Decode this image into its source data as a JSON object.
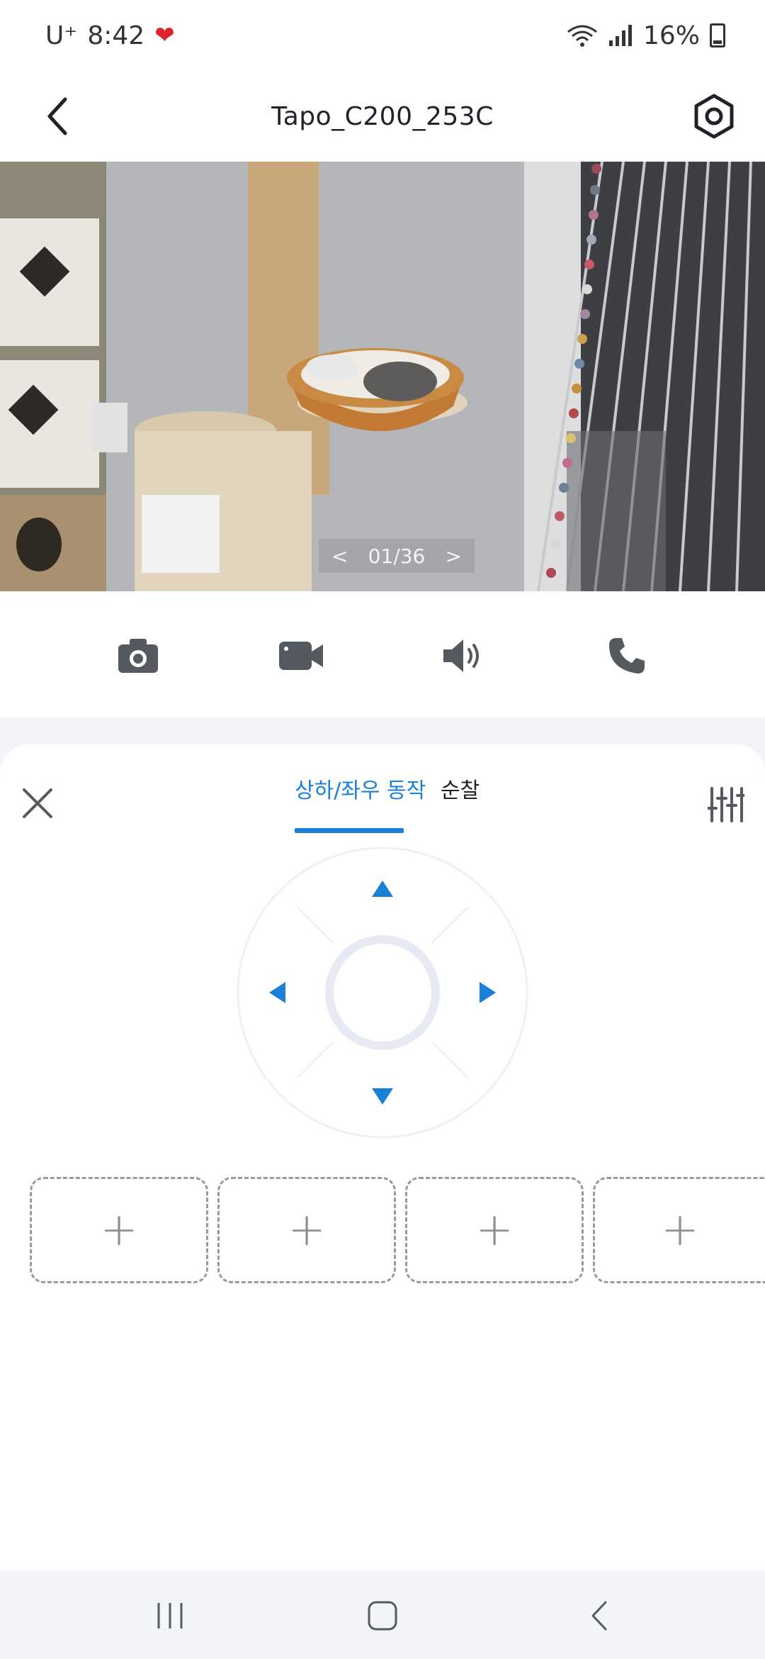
{
  "status": {
    "carrier": "U⁺",
    "time": "8:42",
    "battery": "16%"
  },
  "header": {
    "title": "Tapo_C200_253C"
  },
  "video": {
    "page_counter": "01/36",
    "prev_symbol": "<",
    "next_symbol": ">"
  },
  "controls": [
    "camera-icon",
    "video-camera-icon",
    "speaker-icon",
    "phone-icon"
  ],
  "panel": {
    "tabs": [
      "상하/좌우 동작",
      "순찰"
    ],
    "active_tab": 0
  },
  "presets": [
    {
      "label": "+"
    },
    {
      "label": "+"
    },
    {
      "label": "+"
    },
    {
      "label": "+"
    }
  ],
  "colors": {
    "accent": "#1a7fd6",
    "nav_bg": "#f3f4f7",
    "band_bg": "#f1f3f6"
  }
}
